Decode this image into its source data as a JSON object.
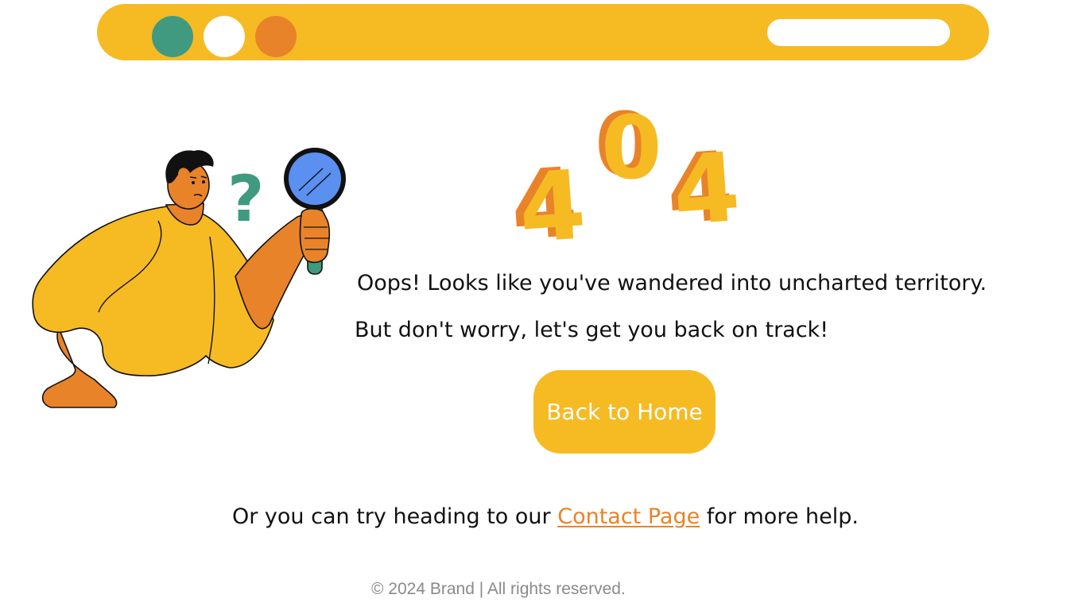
{
  "colors": {
    "accent_yellow": "#f6ba23",
    "accent_orange": "#e8832a",
    "accent_green": "#3f9a80",
    "lens_blue": "#5b8ff0",
    "text": "#111111",
    "footer_text": "#8a8a8a"
  },
  "topbar": {
    "window_dots": [
      "green-dot",
      "white-dot",
      "orange-dot"
    ],
    "address_bar_value": ""
  },
  "illustration": {
    "figure": "man-with-magnifying-glass",
    "icons": [
      "question-mark-icon",
      "magnifying-glass-icon"
    ]
  },
  "error": {
    "digits": [
      "4",
      "0",
      "4"
    ]
  },
  "message": {
    "line1": "Oops! Looks like you've wandered into uncharted territory.",
    "line2": "But don't worry, let's get you back on track!"
  },
  "actions": {
    "home_label": "Back to Home"
  },
  "help": {
    "prefix": "Or you can try heading to our ",
    "link_text": "Contact Page",
    "suffix": " for more help."
  },
  "footer": {
    "text": "© 2024 Brand | All rights reserved."
  }
}
